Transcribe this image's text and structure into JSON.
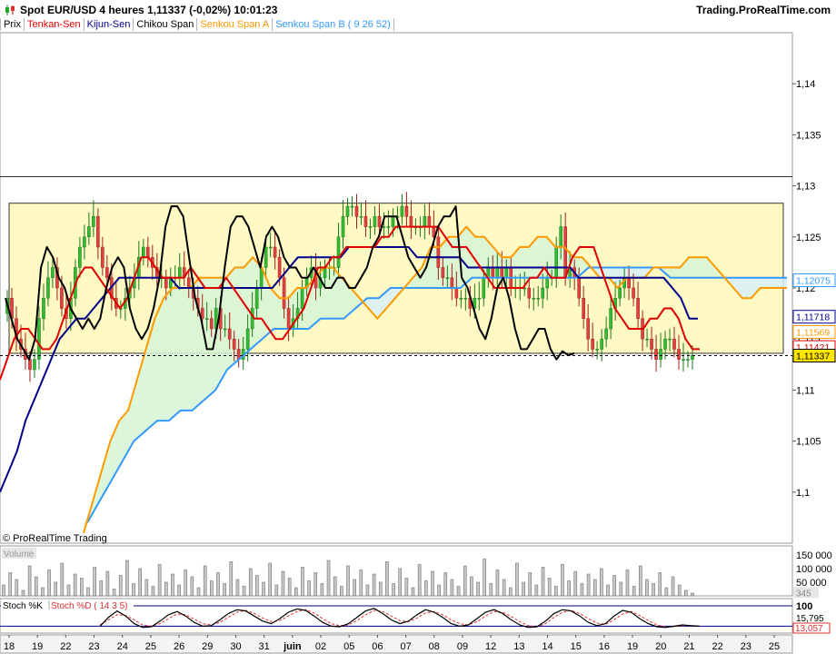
{
  "header": {
    "title": "Spot EUR/USD   4 heures   1,11337 (-0,02%)   10:01:23",
    "brand": "Trading.ProRealTime.com"
  },
  "legend": [
    {
      "label": "Prix",
      "color": "#000000"
    },
    {
      "label": "Tenkan-Sen",
      "color": "#e00000"
    },
    {
      "label": "Kijun-Sen",
      "color": "#00008b"
    },
    {
      "label": "Chikou Span",
      "color": "#000000"
    },
    {
      "label": "Senkou Span A",
      "color": "#ff9900"
    },
    {
      "label": "Senkou Span B ( 9 26 52)",
      "color": "#3399ff"
    }
  ],
  "watermark": "© ProRealTime Trading",
  "chart_data": [
    {
      "type": "line",
      "title": "Spot EUR/USD 4 heures",
      "ylim": [
        1.095,
        1.145
      ],
      "yticks": [
        {
          "v": 1.14,
          "label": "1,14"
        },
        {
          "v": 1.135,
          "label": "1,135"
        },
        {
          "v": 1.13,
          "label": "1,13"
        },
        {
          "v": 1.125,
          "label": "1,125"
        },
        {
          "v": 1.12,
          "label": "1,12"
        },
        {
          "v": 1.115,
          "label": "1,115"
        },
        {
          "v": 1.11,
          "label": "1,11"
        },
        {
          "v": 1.105,
          "label": "1,105"
        },
        {
          "v": 1.1,
          "label": "1,1"
        }
      ],
      "x_labels": [
        "18",
        "19",
        "22",
        "23",
        "24",
        "25",
        "26",
        "29",
        "30",
        "31",
        "juin",
        "02",
        "05",
        "06",
        "07",
        "08",
        "09",
        "12",
        "13",
        "14",
        "15",
        "16",
        "19",
        "20",
        "21",
        "22",
        "23",
        "25"
      ],
      "horizontal_line": 1.1309,
      "range_box": {
        "top": 1.1283,
        "bottom": 1.1136
      },
      "last_price": 1.11337,
      "price_labels": [
        {
          "label": "1,12075",
          "value": 1.12075,
          "color": "#3399ff"
        },
        {
          "label": "1,11718",
          "value": 1.11718,
          "color": "#00008b"
        },
        {
          "label": "1,11569",
          "value": 1.11569,
          "color": "#ff9900"
        },
        {
          "label": "1,11421",
          "value": 1.11421,
          "color": "#e00000"
        },
        {
          "label": "1,11337",
          "value": 1.11337,
          "color": "#000000",
          "bg": "#ffe600"
        }
      ],
      "candles_close": [
        1.119,
        1.117,
        1.115,
        1.114,
        1.113,
        1.112,
        1.113,
        1.117,
        1.119,
        1.121,
        1.122,
        1.12,
        1.118,
        1.117,
        1.119,
        1.122,
        1.124,
        1.125,
        1.126,
        1.127,
        1.124,
        1.122,
        1.121,
        1.119,
        1.118,
        1.118,
        1.119,
        1.12,
        1.121,
        1.123,
        1.124,
        1.123,
        1.122,
        1.121,
        1.121,
        1.12,
        1.121,
        1.121,
        1.122,
        1.121,
        1.12,
        1.119,
        1.118,
        1.117,
        1.117,
        1.116,
        1.118,
        1.116,
        1.116,
        1.115,
        1.114,
        1.113,
        1.114,
        1.116,
        1.118,
        1.12,
        1.122,
        1.124,
        1.124,
        1.123,
        1.121,
        1.118,
        1.116,
        1.117,
        1.118,
        1.12,
        1.121,
        1.122,
        1.12,
        1.121,
        1.122,
        1.122,
        1.122,
        1.125,
        1.127,
        1.128,
        1.128,
        1.127,
        1.127,
        1.126,
        1.126,
        1.127,
        1.126,
        1.126,
        1.126,
        1.127,
        1.127,
        1.128,
        1.127,
        1.126,
        1.126,
        1.126,
        1.127,
        1.126,
        1.125,
        1.122,
        1.121,
        1.121,
        1.12,
        1.119,
        1.119,
        1.119,
        1.118,
        1.119,
        1.119,
        1.121,
        1.122,
        1.121,
        1.122,
        1.121,
        1.122,
        1.12,
        1.12,
        1.12,
        1.12,
        1.119,
        1.119,
        1.119,
        1.12,
        1.121,
        1.121,
        1.124,
        1.126,
        1.121,
        1.122,
        1.121,
        1.119,
        1.117,
        1.115,
        1.114,
        1.114,
        1.115,
        1.116,
        1.118,
        1.119,
        1.12,
        1.121,
        1.12,
        1.119,
        1.117,
        1.115,
        1.115,
        1.114,
        1.113,
        1.114,
        1.115,
        1.115,
        1.114,
        1.113,
        1.113,
        1.113,
        1.1134
      ],
      "tenkan": [
        1.111,
        1.113,
        1.115,
        1.116,
        1.116,
        1.115,
        1.114,
        1.114,
        1.115,
        1.117,
        1.119,
        1.121,
        1.122,
        1.122,
        1.121,
        1.12,
        1.119,
        1.118,
        1.119,
        1.121,
        1.123,
        1.123,
        1.122,
        1.121,
        1.121,
        1.121,
        1.121,
        1.122,
        1.121,
        1.12,
        1.12,
        1.12,
        1.121,
        1.12,
        1.119,
        1.118,
        1.117,
        1.117,
        1.116,
        1.115,
        1.115,
        1.116,
        1.117,
        1.118,
        1.12,
        1.122,
        1.122,
        1.123,
        1.123,
        1.124,
        1.124,
        1.124,
        1.124,
        1.124,
        1.125,
        1.125,
        1.126,
        1.126,
        1.126,
        1.126,
        1.126,
        1.126,
        1.126,
        1.125,
        1.124,
        1.124,
        1.124,
        1.123,
        1.122,
        1.121,
        1.12,
        1.12,
        1.12,
        1.12,
        1.12,
        1.121,
        1.121,
        1.122,
        1.121,
        1.121,
        1.121,
        1.123,
        1.124,
        1.124,
        1.124,
        1.122,
        1.12,
        1.118,
        1.117,
        1.116,
        1.116,
        1.116,
        1.117,
        1.117,
        1.118,
        1.118,
        1.117,
        1.115,
        1.114,
        1.114
      ],
      "kijun": [
        1.1,
        1.102,
        1.104,
        1.107,
        1.109,
        1.111,
        1.113,
        1.115,
        1.116,
        1.117,
        1.117,
        1.118,
        1.119,
        1.12,
        1.121,
        1.121,
        1.121,
        1.121,
        1.121,
        1.121,
        1.121,
        1.12,
        1.12,
        1.12,
        1.12,
        1.12,
        1.12,
        1.12,
        1.12,
        1.12,
        1.12,
        1.12,
        1.12,
        1.121,
        1.122,
        1.123,
        1.123,
        1.123,
        1.123,
        1.123,
        1.123,
        1.124,
        1.124,
        1.124,
        1.124,
        1.124,
        1.124,
        1.124,
        1.124,
        1.123,
        1.123,
        1.123,
        1.123,
        1.123,
        1.123,
        1.122,
        1.122,
        1.122,
        1.122,
        1.122,
        1.122,
        1.122,
        1.122,
        1.122,
        1.122,
        1.122,
        1.122,
        1.122,
        1.121,
        1.121,
        1.121,
        1.121,
        1.121,
        1.121,
        1.121,
        1.121,
        1.121,
        1.121,
        1.121,
        1.12,
        1.119,
        1.117,
        1.117
      ],
      "chikou": [
        1.119,
        1.117,
        1.115,
        1.114,
        1.113,
        1.115,
        1.122,
        1.124,
        1.123,
        1.121,
        1.12,
        1.118,
        1.117,
        1.116,
        1.117,
        1.116,
        1.117,
        1.12,
        1.122,
        1.123,
        1.122,
        1.118,
        1.116,
        1.115,
        1.116,
        1.118,
        1.121,
        1.126,
        1.128,
        1.128,
        1.127,
        1.123,
        1.119,
        1.117,
        1.114,
        1.114,
        1.117,
        1.122,
        1.126,
        1.127,
        1.127,
        1.126,
        1.124,
        1.122,
        1.125,
        1.126,
        1.125,
        1.123,
        1.122,
        1.122,
        1.121,
        1.121,
        1.122,
        1.121,
        1.12,
        1.12,
        1.121,
        1.121,
        1.12,
        1.12,
        1.121,
        1.122,
        1.124,
        1.125,
        1.127,
        1.127,
        1.127,
        1.125,
        1.123,
        1.122,
        1.121,
        1.122,
        1.124,
        1.126,
        1.127,
        1.127,
        1.128,
        1.121,
        1.12,
        1.118,
        1.116,
        1.115,
        1.117,
        1.12,
        1.121,
        1.119,
        1.116,
        1.114,
        1.114,
        1.115,
        1.116,
        1.116,
        1.114,
        1.113,
        1.1138,
        1.1134,
        1.1136
      ],
      "senkou_a": [
        1.096,
        1.099,
        1.102,
        1.105,
        1.107,
        1.108,
        1.111,
        1.114,
        1.117,
        1.119,
        1.12,
        1.12,
        1.12,
        1.121,
        1.121,
        1.121,
        1.121,
        1.122,
        1.122,
        1.123,
        1.122,
        1.12,
        1.119,
        1.119,
        1.12,
        1.12,
        1.121,
        1.122,
        1.122,
        1.121,
        1.12,
        1.119,
        1.118,
        1.117,
        1.118,
        1.119,
        1.12,
        1.121,
        1.122,
        1.124,
        1.124,
        1.125,
        1.125,
        1.126,
        1.125,
        1.125,
        1.124,
        1.123,
        1.123,
        1.124,
        1.124,
        1.125,
        1.125,
        1.124,
        1.124,
        1.123,
        1.123,
        1.122,
        1.121,
        1.121,
        1.12,
        1.121,
        1.121,
        1.121,
        1.122,
        1.122,
        1.122,
        1.122,
        1.123,
        1.123,
        1.123,
        1.122,
        1.121,
        1.12,
        1.119,
        1.119,
        1.12,
        1.12,
        1.12,
        1.12
      ],
      "senkou_b": [
        1.097,
        1.099,
        1.101,
        1.103,
        1.105,
        1.106,
        1.107,
        1.107,
        1.108,
        1.108,
        1.109,
        1.11,
        1.112,
        1.113,
        1.114,
        1.115,
        1.116,
        1.116,
        1.116,
        1.116,
        1.117,
        1.117,
        1.117,
        1.118,
        1.119,
        1.119,
        1.12,
        1.12,
        1.12,
        1.12,
        1.12,
        1.12,
        1.12,
        1.121,
        1.121,
        1.121,
        1.121,
        1.121,
        1.121,
        1.121,
        1.121,
        1.121,
        1.121,
        1.122,
        1.122,
        1.122,
        1.122,
        1.122,
        1.122,
        1.122,
        1.121,
        1.121,
        1.121,
        1.121,
        1.121,
        1.121,
        1.121,
        1.121,
        1.121,
        1.121,
        1.121
      ]
    },
    {
      "type": "bar",
      "title": "Volume",
      "ylim": [
        0,
        170000
      ],
      "yticks": [
        {
          "v": 150000,
          "label": "150 000"
        },
        {
          "v": 100000,
          "label": "100 000"
        },
        {
          "v": 50000,
          "label": "50 000"
        }
      ],
      "last_label": "345",
      "values": [
        40000,
        85000,
        60000,
        20000,
        110000,
        70000,
        30000,
        95000,
        50000,
        120000,
        40000,
        80000,
        65000,
        30000,
        105000,
        55000,
        90000,
        25000,
        75000,
        130000,
        45000,
        100000,
        60000,
        35000,
        115000,
        50000,
        80000,
        40000,
        95000,
        70000,
        30000,
        110000,
        55000,
        85000,
        45000,
        125000,
        60000,
        35000,
        100000,
        75000,
        50000,
        120000,
        40000,
        90000,
        65000,
        30000,
        105000,
        55000,
        85000,
        45000,
        130000,
        70000,
        35000,
        110000,
        60000,
        95000,
        40000,
        80000,
        50000,
        125000,
        45000,
        100000,
        65000,
        30000,
        115000,
        55000,
        90000,
        40000,
        85000,
        60000,
        35000,
        110000,
        70000,
        50000,
        135000,
        45000,
        95000,
        60000,
        30000,
        120000,
        50000,
        85000,
        40000,
        105000,
        65000,
        35000,
        115000,
        55000,
        90000,
        45000,
        80000,
        60000,
        100000,
        40000,
        75000,
        50000,
        95000,
        35000,
        110000,
        60000,
        45000,
        85000,
        30000,
        70000,
        40000,
        20000,
        10000
      ]
    },
    {
      "type": "line",
      "title": "Stoch %K",
      "series": [
        {
          "name": "Stoch %K",
          "values": [
            20,
            55,
            80,
            60,
            30,
            15,
            18,
            40,
            65,
            78,
            60,
            35,
            20,
            22,
            45,
            70,
            85,
            80,
            60,
            40,
            30,
            50,
            75,
            88,
            82,
            60,
            35,
            20,
            18,
            30,
            55,
            80,
            90,
            70,
            45,
            30,
            40,
            65,
            85,
            75,
            55,
            30,
            20,
            25,
            50,
            75,
            85,
            70,
            45,
            25,
            15,
            18,
            40,
            70,
            85,
            80,
            60,
            35,
            22,
            30,
            60,
            82,
            75,
            50,
            30,
            18,
            15,
            20,
            25,
            22,
            20
          ]
        },
        {
          "name": "Stoch %D ( 14 3 5)",
          "values": [
            25,
            45,
            65,
            62,
            45,
            25,
            20,
            30,
            50,
            68,
            65,
            48,
            30,
            25,
            35,
            55,
            75,
            82,
            70,
            52,
            38,
            42,
            60,
            78,
            85,
            72,
            50,
            30,
            22,
            25,
            42,
            65,
            82,
            78,
            60,
            42,
            38,
            52,
            72,
            78,
            65,
            45,
            30,
            25,
            38,
            60,
            78,
            75,
            58,
            38,
            22,
            18,
            30,
            55,
            75,
            82,
            70,
            50,
            32,
            28,
            45,
            68,
            78,
            62,
            42,
            25,
            18,
            18,
            22,
            22,
            21
          ]
        }
      ],
      "ylim": [
        0,
        100
      ],
      "yticks": [
        {
          "v": 100,
          "label": "100"
        }
      ],
      "k_label": "15,795",
      "d_label": "13,057"
    }
  ]
}
